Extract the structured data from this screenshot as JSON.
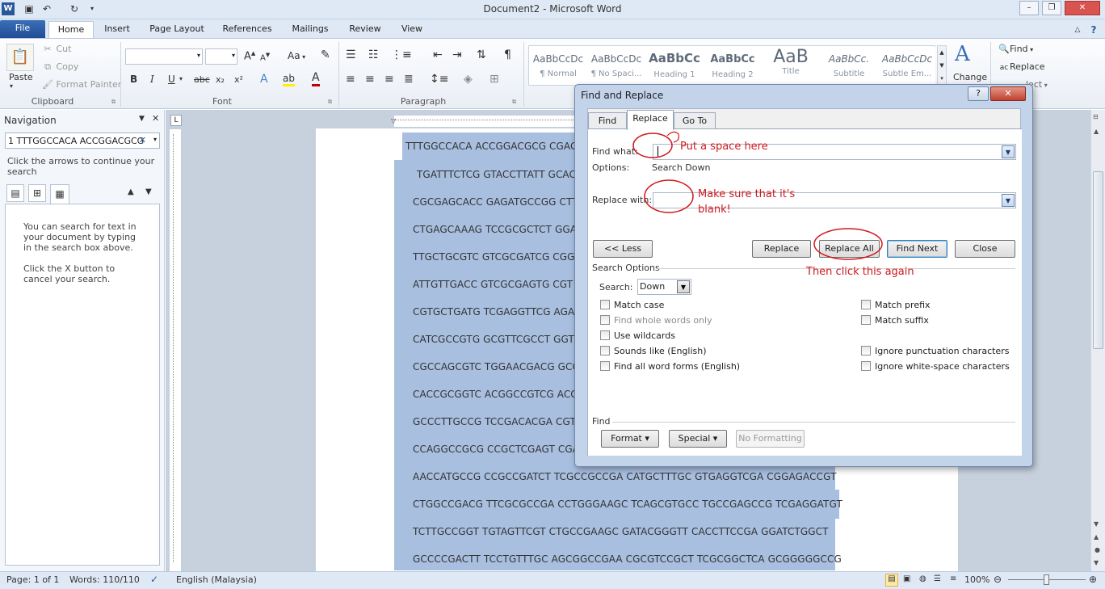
{
  "window": {
    "title": "Document2 - Microsoft Word",
    "controls": [
      "minimize-icon",
      "restore-icon",
      "close-icon"
    ]
  },
  "ribbon_tabs": [
    "File",
    "Home",
    "Insert",
    "Page Layout",
    "References",
    "Mailings",
    "Review",
    "View"
  ],
  "clipboard": {
    "paste": "Paste",
    "cut": "Cut",
    "copy": "Copy",
    "format_painter": "Format Painter",
    "label": "Clipboard"
  },
  "font": {
    "label": "Font",
    "bold": "B",
    "italic": "I",
    "underline": "U",
    "strike": "abc",
    "sub": "x₂",
    "sup": "x²",
    "grow": "A",
    "case": "Aa",
    "color_a": "A"
  },
  "paragraph": {
    "label": "Paragraph"
  },
  "styles": [
    {
      "sample": "AaBbCcDc",
      "name": "¶ Normal"
    },
    {
      "sample": "AaBbCcDc",
      "name": "¶ No Spaci..."
    },
    {
      "sample": "AaBbCc",
      "name": "Heading 1"
    },
    {
      "sample": "AaBbCc",
      "name": "Heading 2"
    },
    {
      "sample": "AaB",
      "name": "Title"
    },
    {
      "sample": "AaBbCc.",
      "name": "Subtitle"
    },
    {
      "sample": "AaBbCcDc",
      "name": "Subtle Em..."
    }
  ],
  "editing": {
    "change_styles": "Change",
    "find": "Find",
    "replace": "Replace",
    "select": "lect"
  },
  "navigation": {
    "title": "Navigation",
    "search_value": "1 TTTGGCCACA ACCGGACGCG",
    "hint": "Click the arrows to continue your search",
    "info1": "You can search for text in your document by typing in the search box above.",
    "info2": "Click the X button to cancel your search."
  },
  "document_lines": [
    "TTTGGCCACA ACCGGACGCG CGAG",
    "TGATTTCTCG GTACCTTATT GCAC",
    "CGCGAGCACC GAGATGCCGG CTT",
    "CTGAGCAAAG TCCGCGCTCT GGA",
    "TTGCTGCGTC GTCGCGATCG CGG",
    "ATTGTTGACC GTCGCGAGTG CGT",
    "CGTGCTGATG TCGAGGTTCG AGA",
    "CATCGCCGTG GCGTTCGCCT GGT",
    "CGCCAGCGTC TGGAACGACG GCG",
    "CACCGCGGTC ACGGCCGTCG ACG",
    "GCCCTTGCCG TCCGACACGA CGT",
    "CCAGGCCGCG CCGCTCGAGT CGA",
    "AACCATGCCG CCGCCGATCT TCGCCGCCGA CATGCTTTGC GTGAGGTCGA CGGAGACCGT",
    "CTGGCCGACG TTCGCGCCGA CCTGGGAAGC TCAGCGTGCC TGCCGAGCCG TCGAGGATGT",
    "TCTTGCCGGT TGTAGTTCGT CTGCCGAAGC GATACGGGTT CACCTTCCGA GGATCTGGCT",
    "GCCCCGACTT TCCTGTTTGC AGCGGCCGAA CGCGTCCGCT TCGCGGCTCA GCGGGGGCCG"
  ],
  "dialog": {
    "title": "Find and Replace",
    "help": "?",
    "tabs": [
      "Find",
      "Replace",
      "Go To"
    ],
    "find_what_label": "Find what:",
    "find_what_value": "",
    "options_label": "Options:",
    "options_value": "Search Down",
    "replace_with_label": "Replace with:",
    "replace_with_value": "",
    "buttons": {
      "less": "<< Less",
      "replace": "Replace",
      "replace_all": "Replace All",
      "find_next": "Find Next",
      "close": "Close"
    },
    "search_options_label": "Search Options",
    "search_label": "Search:",
    "search_value": "Down",
    "checkboxes_left": [
      "Match case",
      "Find whole words only",
      "Use wildcards",
      "Sounds like (English)",
      "Find all word forms (English)"
    ],
    "checkboxes_right": [
      "Match prefix",
      "Match suffix",
      "Ignore punctuation characters",
      "Ignore white-space characters"
    ],
    "find_section_label": "Find",
    "format_btn": "Format ▾",
    "special_btn": "Special ▾",
    "no_formatting_btn": "No Formatting"
  },
  "annotations": {
    "a1": "Put a space here",
    "a2": "Make sure that it's",
    "a2b": "blank!",
    "a3": "Then click this again"
  },
  "status": {
    "page": "Page: 1 of 1",
    "words": "Words: 110/110",
    "language": "English (Malaysia)",
    "zoom": "100%"
  },
  "colors": {
    "accent": "#2b579a",
    "selection": "#a8bfe0",
    "annotation": "#d0191d"
  }
}
